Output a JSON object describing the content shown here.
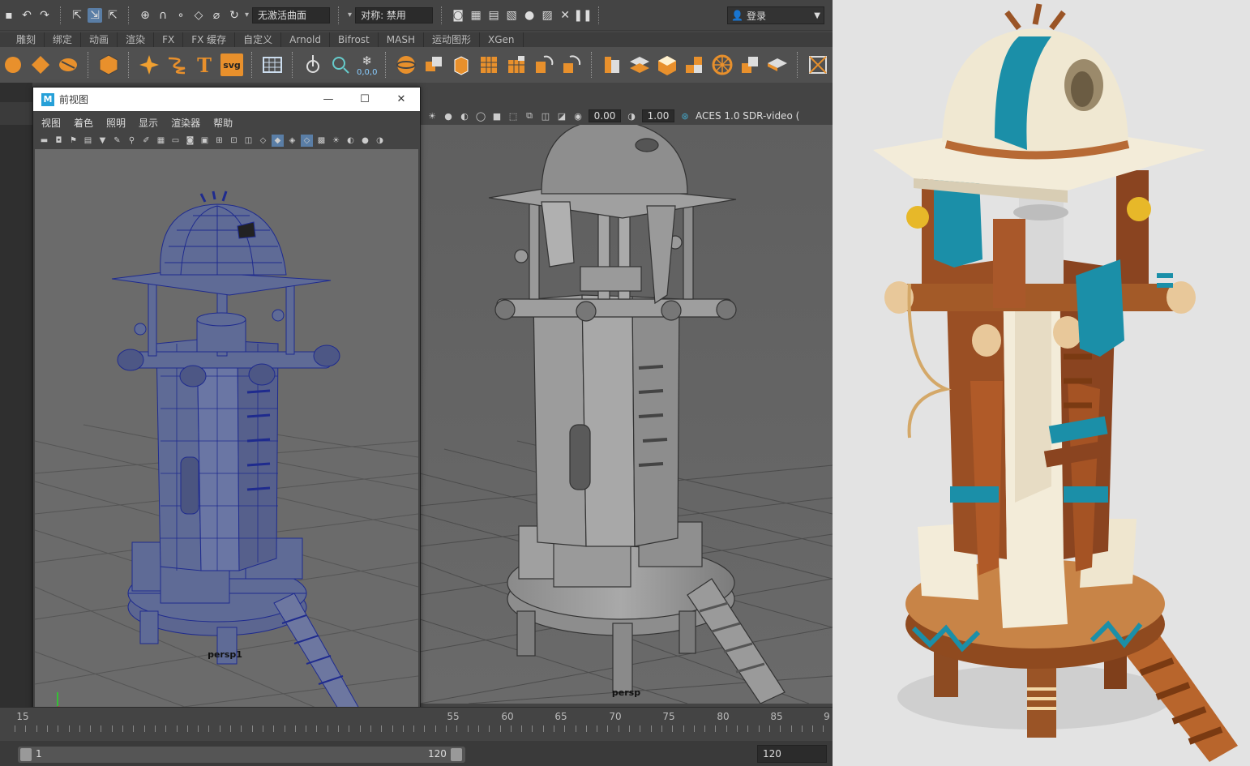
{
  "statusline": {
    "field_inactive_surface": "无激活曲面",
    "field_symmetry": "对称: 禁用",
    "login_label": "登录"
  },
  "shelf_tabs": [
    "雕刻",
    "绑定",
    "动画",
    "渲染",
    "FX",
    "FX 缓存",
    "自定义",
    "Arnold",
    "Bifrost",
    "MASH",
    "运动图形",
    "XGen"
  ],
  "shelf_icons": [
    "sculpt-icon",
    "diamond-icon",
    "split-icon",
    "polyhedron-icon",
    "star-icon",
    "spring-icon",
    "type-icon",
    "svg-icon",
    "grid-icon",
    "xform-icon",
    "locator-icon",
    "particle-icon",
    "sphere-icon",
    "cube-icon",
    "extrude-icon",
    "checker-icon",
    "checker2-icon",
    "transfer-icon",
    "transfer2-icon",
    "stack-icon",
    "layers-icon",
    "box-icon",
    "blocks-icon",
    "wheel-icon",
    "flip-icon",
    "plane-icon",
    "frame-icon"
  ],
  "shelf_svg_label": "svg",
  "shelf_text_label": "T",
  "particle_readout": "0,0,0",
  "persp_panel": {
    "field_a": "0.00",
    "field_b": "1.00",
    "color_space": "ACES 1.0 SDR-video (",
    "camera_label": "persp"
  },
  "front_window": {
    "logo": "M",
    "title": "前视图",
    "menu": [
      "视图",
      "着色",
      "照明",
      "显示",
      "渲染器",
      "帮助"
    ],
    "camera_label": "persp1"
  },
  "timeline": {
    "visible_ticks": [
      "15",
      "55",
      "60",
      "65",
      "70",
      "75",
      "80",
      "85",
      "9"
    ],
    "range_start": "1",
    "range_end": "120",
    "range_out": "120"
  },
  "colors": {
    "ui_dark": "#444444",
    "viewport": "#636363",
    "wire": "#1f2b8e",
    "active": "#5a7ea6",
    "concept_bg": "#e3e3e3",
    "teal": "#1b8fa8",
    "wood": "#9a4f24",
    "cream": "#f3ecd9"
  }
}
